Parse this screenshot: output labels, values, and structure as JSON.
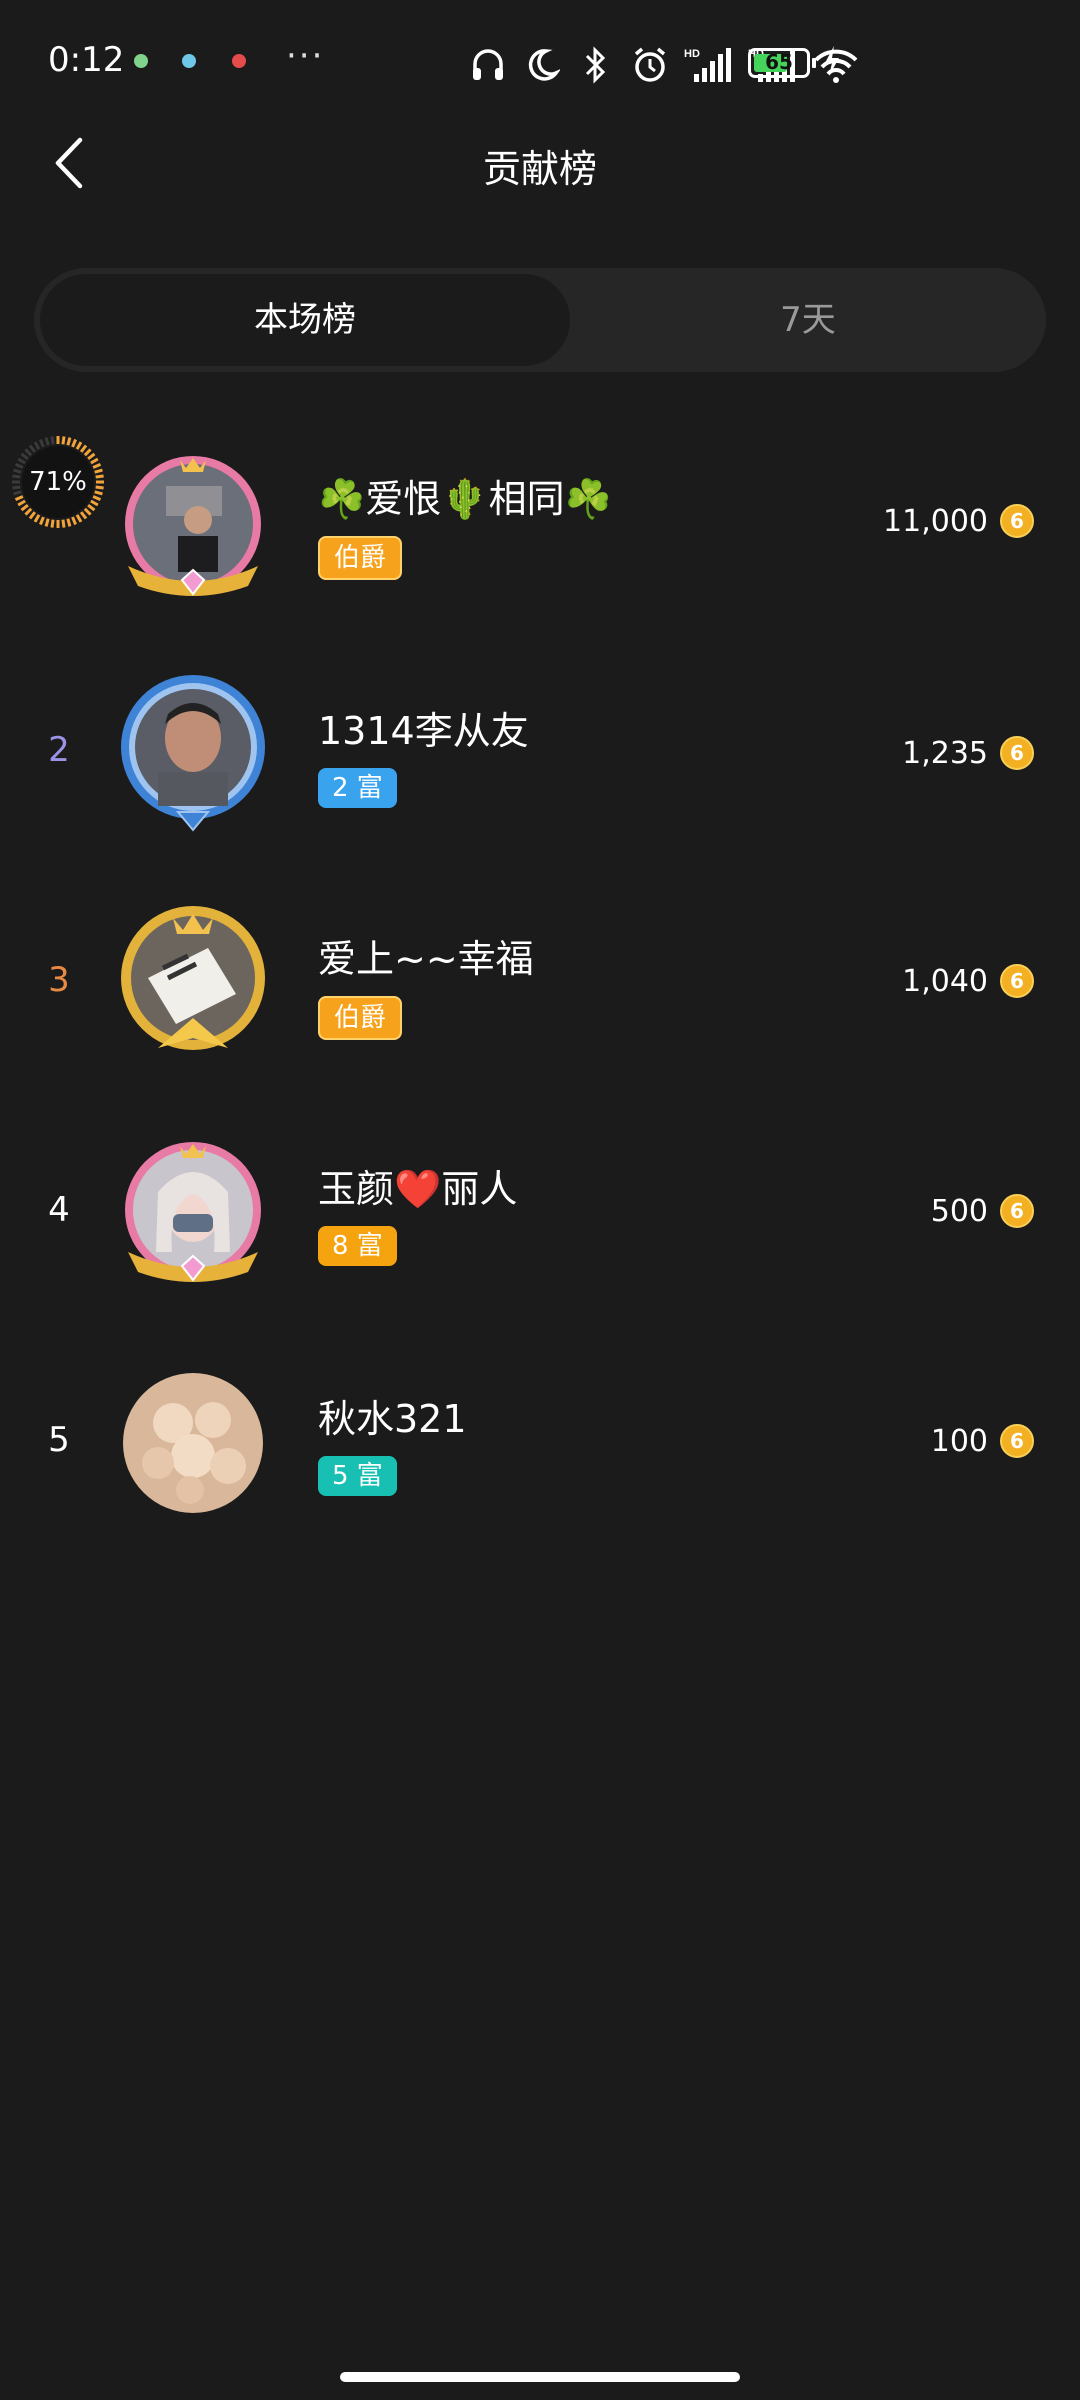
{
  "status_bar": {
    "time": "0:12",
    "more": "···",
    "battery": "65",
    "battery_level": 0.65,
    "icons": [
      "headphones-icon",
      "moon-icon",
      "bluetooth-icon",
      "alarm-icon",
      "hd-signal-icon",
      "hd-signal-icon",
      "wifi-icon"
    ]
  },
  "header": {
    "title": "贡献榜"
  },
  "tabs": [
    {
      "label": "本场榜",
      "active": true
    },
    {
      "label": "7天",
      "active": false
    }
  ],
  "progress_indicator": {
    "label": "71%",
    "value": 0.71
  },
  "ranking": [
    {
      "rank": "",
      "name": "☘️爱恨🌵相同☘️",
      "badge": "伯爵",
      "badge_type": "title",
      "value": "11,000",
      "coin": "6"
    },
    {
      "rank": "2",
      "name": "1314李从友",
      "badge": "2 富",
      "badge_type": "blue",
      "value": "1,235",
      "coin": "6"
    },
    {
      "rank": "3",
      "name": "爱上~~幸福",
      "badge": "伯爵",
      "badge_type": "title",
      "value": "1,040",
      "coin": "6"
    },
    {
      "rank": "4",
      "name": "玉颜❤️丽人",
      "badge": "8 富",
      "badge_type": "orange",
      "value": "500",
      "coin": "6"
    },
    {
      "rank": "5",
      "name": "秋水321",
      "badge": "5 富",
      "badge_type": "teal",
      "value": "100",
      "coin": "6"
    }
  ],
  "colors": {
    "background": "#1b1b1b",
    "rank2": "#9b94e6",
    "rank3": "#e88a44",
    "badge_blue": "#3aa3ee",
    "badge_orange": "#f5a30f",
    "badge_teal": "#18c0b4",
    "badge_title": "#f7a21d",
    "coin": "#f2b022"
  }
}
